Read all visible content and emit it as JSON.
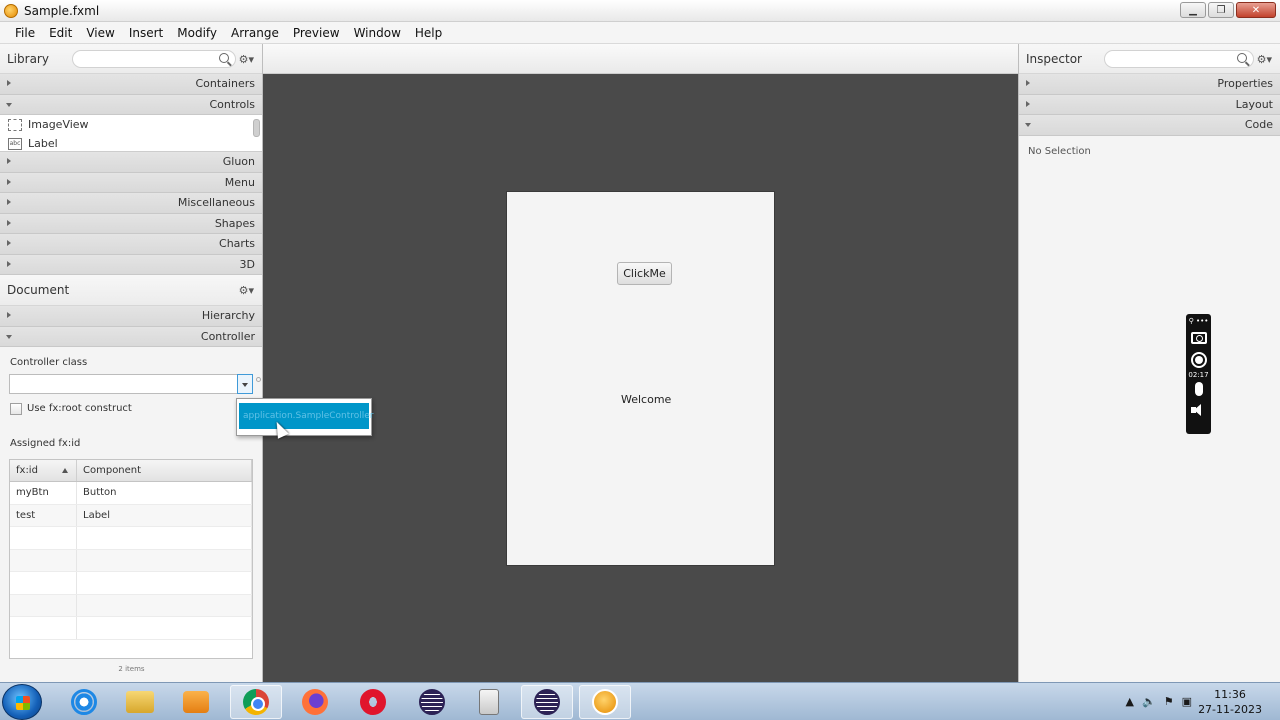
{
  "window": {
    "title": "Sample.fxml"
  },
  "menu": [
    "File",
    "Edit",
    "View",
    "Insert",
    "Modify",
    "Arrange",
    "Preview",
    "Window",
    "Help"
  ],
  "library": {
    "title": "Library",
    "sections_top": [
      {
        "label": "Containers",
        "expanded": false
      },
      {
        "label": "Controls",
        "expanded": true
      }
    ],
    "items": [
      {
        "label": "ImageView",
        "icon": "imageview-icon"
      },
      {
        "label": "Label",
        "icon": "label-icon"
      }
    ],
    "sections_bottom": [
      {
        "label": "Gluon"
      },
      {
        "label": "Menu"
      },
      {
        "label": "Miscellaneous"
      },
      {
        "label": "Shapes"
      },
      {
        "label": "Charts"
      },
      {
        "label": "3D"
      }
    ]
  },
  "document": {
    "title": "Document",
    "sections": [
      {
        "label": "Hierarchy",
        "expanded": false
      },
      {
        "label": "Controller",
        "expanded": true
      }
    ],
    "controller_class_label": "Controller class",
    "controller_class_value": "",
    "fxroot_label": "Use fx:root construct",
    "assigned_label": "Assigned fx:id",
    "table": {
      "headers": [
        "fx:id",
        "Component"
      ],
      "rows": [
        [
          "myBtn",
          "Button"
        ],
        [
          "test",
          "Label"
        ]
      ]
    },
    "items_count": "2 items",
    "dropdown_option": "application.SampleController"
  },
  "stage": {
    "button_label": "ClickMe",
    "label_text": "Welcome"
  },
  "inspector": {
    "title": "Inspector",
    "sections": [
      {
        "label": "Properties",
        "expanded": false
      },
      {
        "label": "Layout",
        "expanded": false
      },
      {
        "label": "Code",
        "expanded": true
      }
    ],
    "empty_text": "No Selection"
  },
  "recorder": {
    "time": "02:17",
    "top": "⚲ •••"
  },
  "taskbar": {
    "time": "11:36",
    "date": "27-11-2023"
  },
  "colors": {
    "canvas": "#4a4a4a",
    "selection": "#0096c9",
    "stage": "#f4f4f4"
  }
}
